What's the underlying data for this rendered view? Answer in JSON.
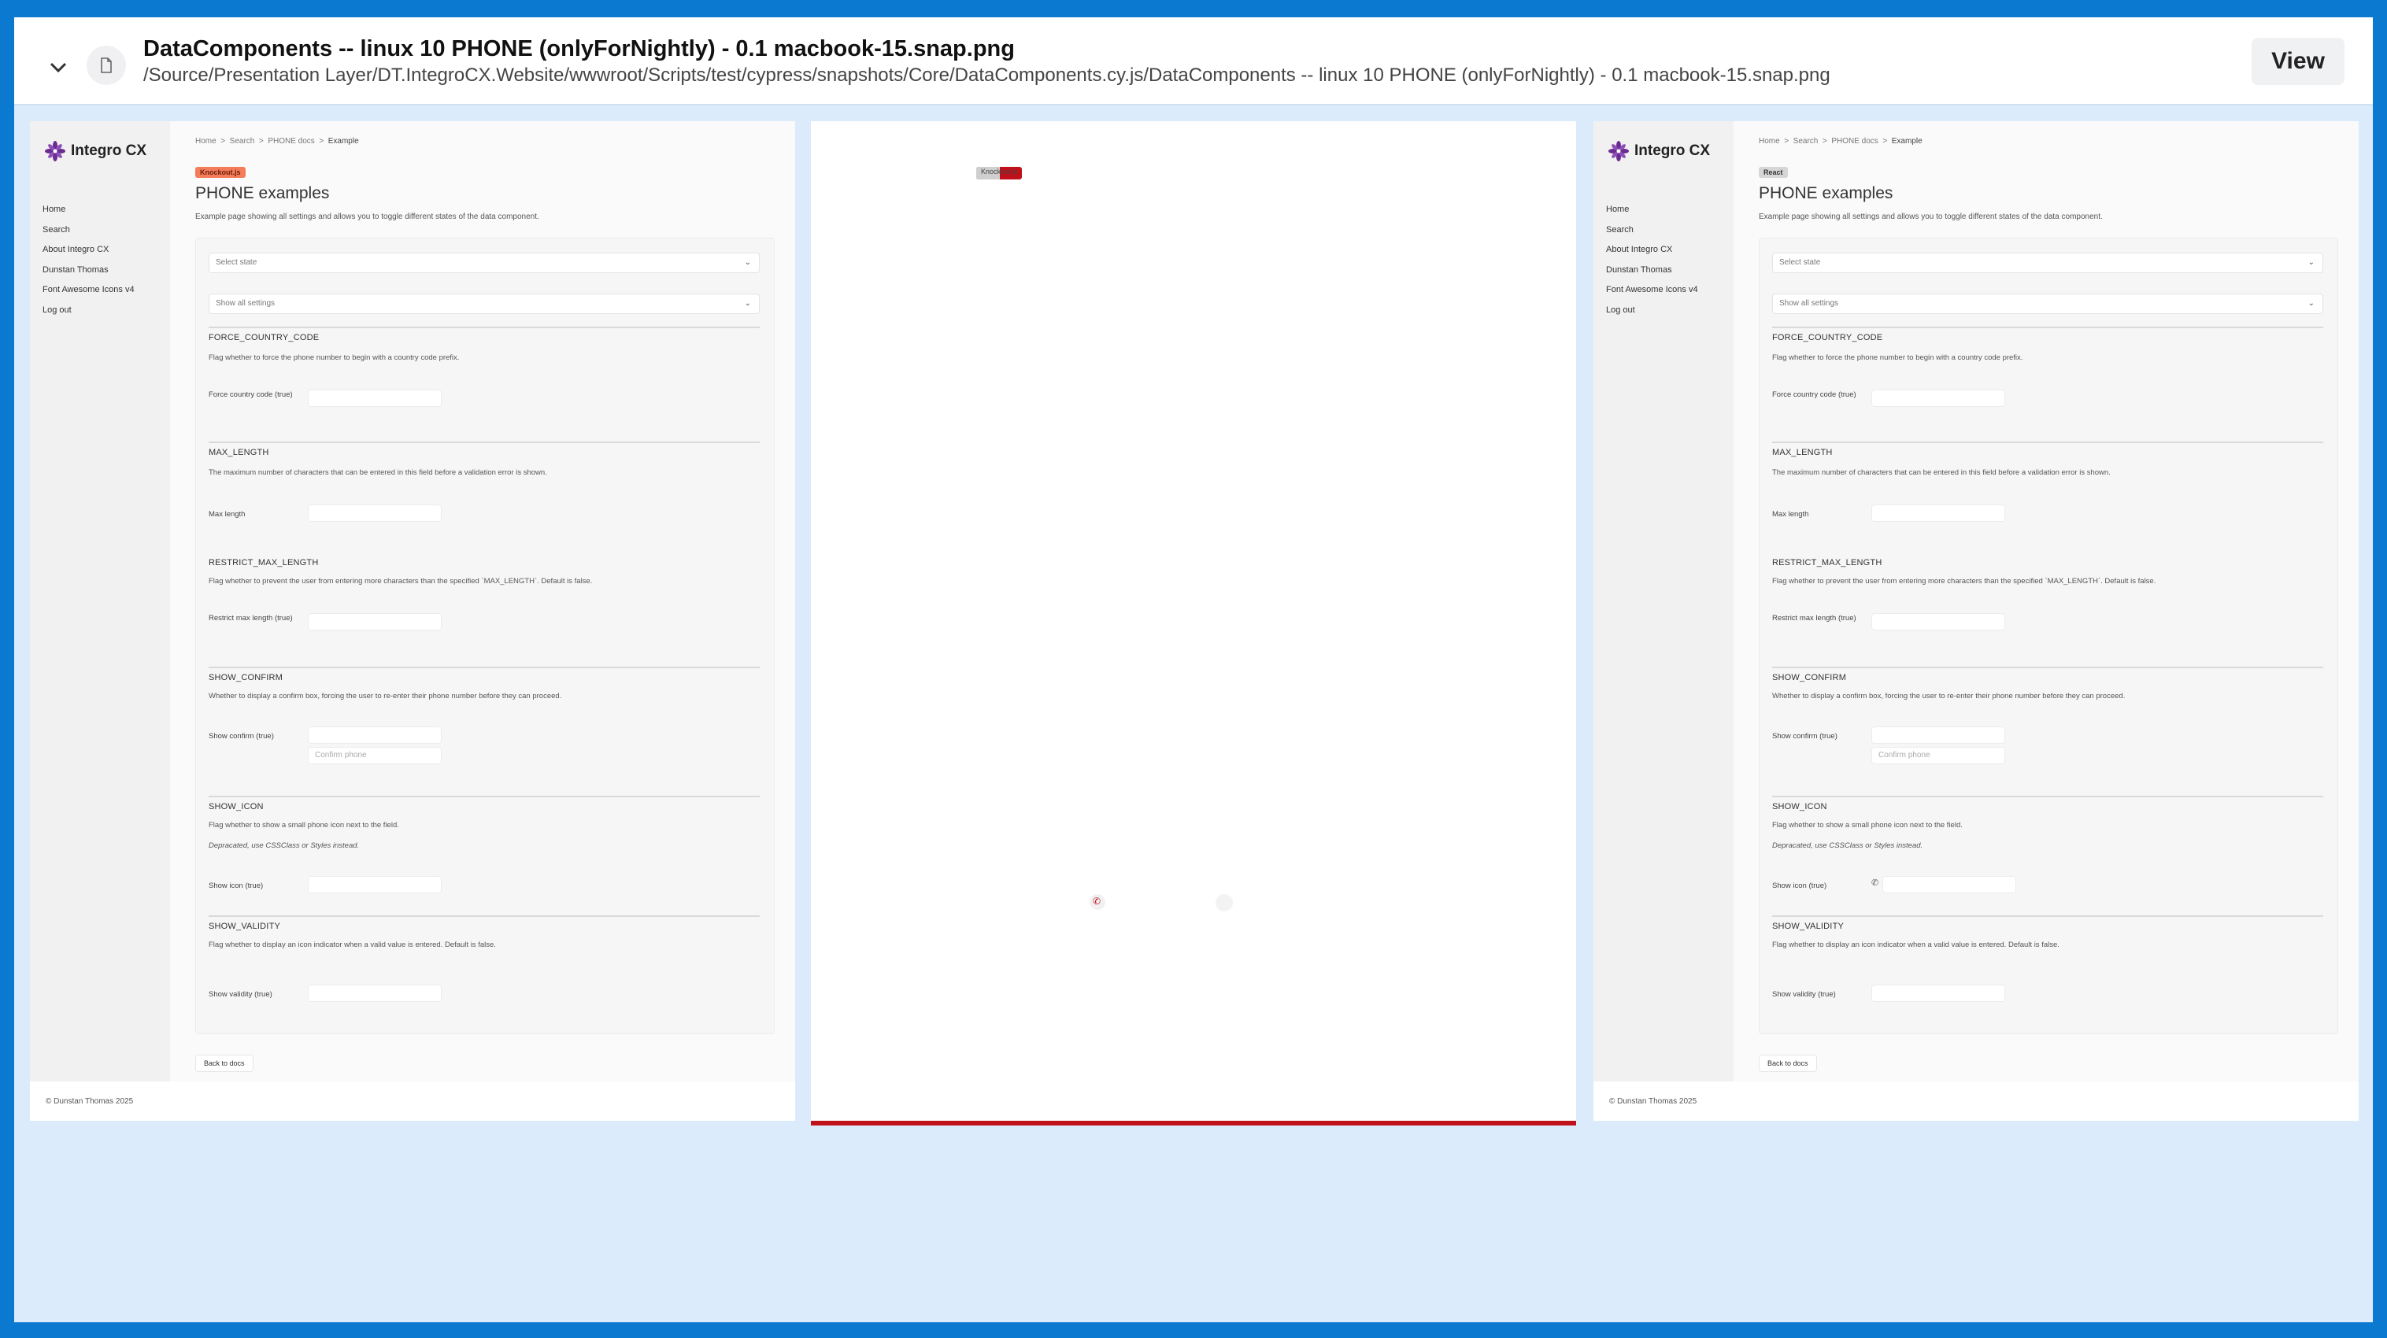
{
  "header": {
    "title": "DataComponents -- linux 10 PHONE (onlyForNightly) - 0.1 macbook-15.snap.png",
    "path": "/Source/Presentation Layer/DT.IntegroCX.Website/wwwroot/Scripts/test/cypress/snapshots/Core/DataComponents.cy.js/DataComponents -- linux 10 PHONE (onlyForNightly) - 0.1 macbook-15.snap.png",
    "view_label": "View"
  },
  "app": {
    "logo_text": "Integro CX",
    "nav": [
      "Home",
      "Search",
      "About Integro CX",
      "Dunstan Thomas",
      "Font Awesome Icons v4",
      "Log out"
    ],
    "breadcrumb": [
      "Home",
      "Search",
      "PHONE docs",
      "Example"
    ],
    "breadcrumb_sep": ">",
    "page_title": "PHONE examples",
    "page_desc": "Example page showing all settings and allows you to toggle different states of the data component.",
    "select_state_placeholder": "Select state",
    "settings_select_value": "Show all settings",
    "sections": {
      "force_country_code": {
        "title": "FORCE_COUNTRY_CODE",
        "desc": "Flag whether to force the phone number to begin with a country code prefix.",
        "label": "Force country code (true)"
      },
      "max_length": {
        "title": "MAX_LENGTH",
        "desc": "The maximum number of characters that can be entered in this field before a validation error is shown.",
        "label": "Max length"
      },
      "restrict_max_length": {
        "title": "RESTRICT_MAX_LENGTH",
        "desc": "Flag whether to prevent the user from entering more characters than the specified `MAX_LENGTH`. Default is false.",
        "label": "Restrict max length (true)"
      },
      "show_confirm": {
        "title": "SHOW_CONFIRM",
        "desc": "Whether to display a confirm box, forcing the user to re-enter their phone number before they can proceed.",
        "label": "Show confirm (true)",
        "confirm_placeholder": "Confirm phone"
      },
      "show_icon": {
        "title": "SHOW_ICON",
        "desc": "Flag whether to show a small phone icon next to the field.",
        "note": "Depracated, use CSSClass or Styles instead.",
        "label": "Show icon (true)"
      },
      "show_validity": {
        "title": "SHOW_VALIDITY",
        "desc": "Flag whether to display an icon indicator when a valid value is entered. Default is false.",
        "label": "Show validity (true)"
      }
    },
    "back_label": "Back to docs",
    "copyright": "© Dunstan Thomas 2025",
    "phone_icon": "phone-icon"
  },
  "panels": {
    "left_badge": "Knockout.js",
    "left_badge_color": "#f47c5a",
    "right_badge": "React",
    "right_badge_color": "#d6d6d6",
    "diff_tag": "Knockout.js",
    "diff_color": "#c0111a"
  }
}
